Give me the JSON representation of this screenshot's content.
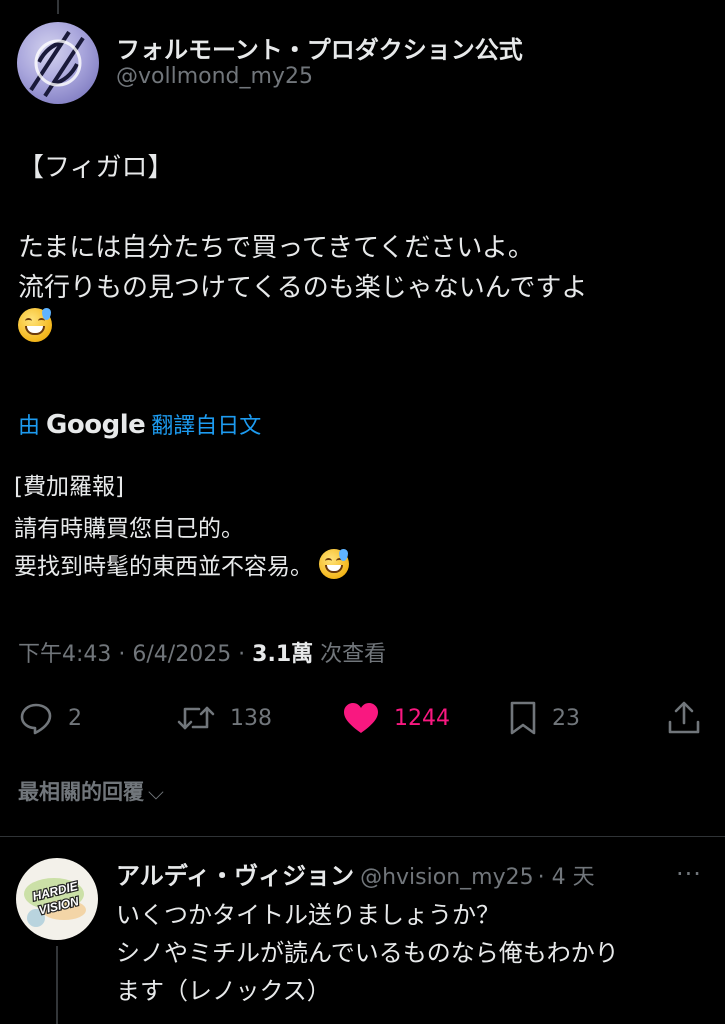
{
  "post": {
    "author_name": "フォルモーント・プロダクション公式",
    "author_handle": "@vollmond_my25",
    "lines": [
      "【フィガロ】",
      "たまには自分たちで買ってきてくださいよ。",
      "流行りもの見つけてくるのも楽じゃないんですよ"
    ],
    "emoji": "sweat-smile-emoji",
    "translation": {
      "prefix": "由",
      "provider": "Google",
      "label": "翻譯自日文",
      "lines": [
        "[費加羅報]",
        "請有時購買您自己的。",
        "要找到時髦的東西並不容易。"
      ]
    },
    "timestamp": "下午4:43 · 6/4/2025 · ",
    "views_count": "3.1萬",
    "views_label": " 次查看"
  },
  "actions": {
    "reply_count": "2",
    "retweet_count": "138",
    "like_count": "1244",
    "bookmark_count": "23",
    "like_color": "#f91880"
  },
  "replies_sort": {
    "label": "最相關的回覆",
    "chevron": "⌵"
  },
  "reply": {
    "author_name": "アルディ・ヴィジョン",
    "author_handle": "@hvision_my25",
    "age": "· 4 天",
    "more": "···",
    "avatar_text": "HARDIE VISION",
    "lines": [
      "いくつかタイトル送りましょうか？",
      "シノやミチルが読んでいるものなら俺もわかり",
      "ます（レノックス）"
    ]
  }
}
